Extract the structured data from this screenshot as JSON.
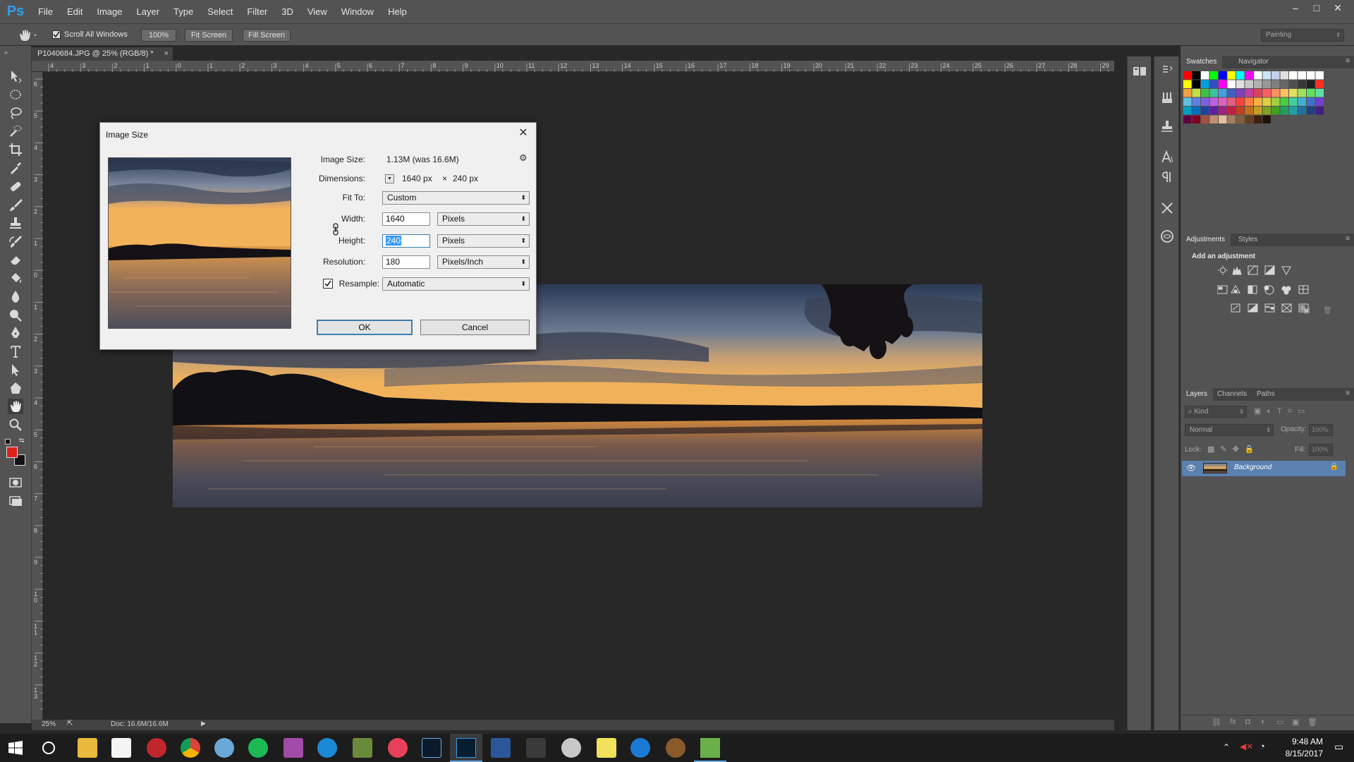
{
  "app": {
    "logo": "Ps",
    "menu": [
      "File",
      "Edit",
      "Image",
      "Layer",
      "Type",
      "Select",
      "Filter",
      "3D",
      "View",
      "Window",
      "Help"
    ],
    "window_controls": [
      "–",
      "□",
      "✕"
    ]
  },
  "options_bar": {
    "scroll_all_windows_label": "Scroll All Windows",
    "scroll_all_windows_checked": true,
    "zoom_100_label": "100%",
    "fit_screen_label": "Fit Screen",
    "fill_screen_label": "Fill Screen",
    "workspace": "Painting"
  },
  "document": {
    "tab_title": "P1040684.JPG @ 25% (RGB/8) *",
    "tab_close": "×",
    "ruler_top_labels": [
      "4",
      "3",
      "2",
      "1",
      "0",
      "1",
      "2",
      "3",
      "4",
      "5",
      "6",
      "7",
      "8",
      "9",
      "10",
      "11",
      "12",
      "13",
      "14",
      "15",
      "16",
      "17",
      "18",
      "19",
      "20",
      "21",
      "22",
      "23",
      "24",
      "25",
      "26",
      "27",
      "28",
      "29"
    ],
    "ruler_left_labels": [
      "6",
      "5",
      "4",
      "3",
      "2",
      "1",
      "0",
      "1",
      "2",
      "3",
      "4",
      "5",
      "6",
      "7",
      "8",
      "9",
      "1 0",
      "1 1",
      "1 2",
      "1 3"
    ],
    "status_zoom": "25%",
    "status_doc": "Doc: 16.6M/16.6M"
  },
  "dialog": {
    "title": "Image Size",
    "close": "✕",
    "image_size_label": "Image Size:",
    "image_size_value": "1.13M (was 16.6M)",
    "dimensions_label": "Dimensions:",
    "dimensions_w": "1640 px",
    "dimensions_x": "×",
    "dimensions_h": "240 px",
    "fit_to_label": "Fit To:",
    "fit_to_value": "Custom",
    "width_label": "Width:",
    "width_value": "1640",
    "width_unit": "Pixels",
    "height_label": "Height:",
    "height_value": "240",
    "height_unit": "Pixels",
    "resolution_label": "Resolution:",
    "resolution_value": "180",
    "resolution_unit": "Pixels/Inch",
    "resample_label": "Resample:",
    "resample_checked": true,
    "resample_value": "Automatic",
    "ok_label": "OK",
    "cancel_label": "Cancel"
  },
  "panels": {
    "swatches_tab": "Swatches",
    "navigator_tab": "Navigator",
    "adjustments_tab": "Adjustments",
    "styles_tab": "Styles",
    "add_adjustment_label": "Add an adjustment",
    "layers_tab": "Layers",
    "channels_tab": "Channels",
    "paths_tab": "Paths",
    "kind_filter": "Kind",
    "blend_mode": "Normal",
    "opacity_label": "Opacity:",
    "opacity_value": "100%",
    "lock_label": "Lock:",
    "fill_label": "Fill:",
    "fill_value": "100%",
    "layer_name": "Background"
  },
  "taskbar": {
    "time": "9:48 AM",
    "date": "8/15/2017"
  },
  "colors": {
    "foreground": "#e0201c",
    "background": "#111111",
    "ps_blue": "#2da0f0",
    "selected_layer": "#5a81b0"
  }
}
